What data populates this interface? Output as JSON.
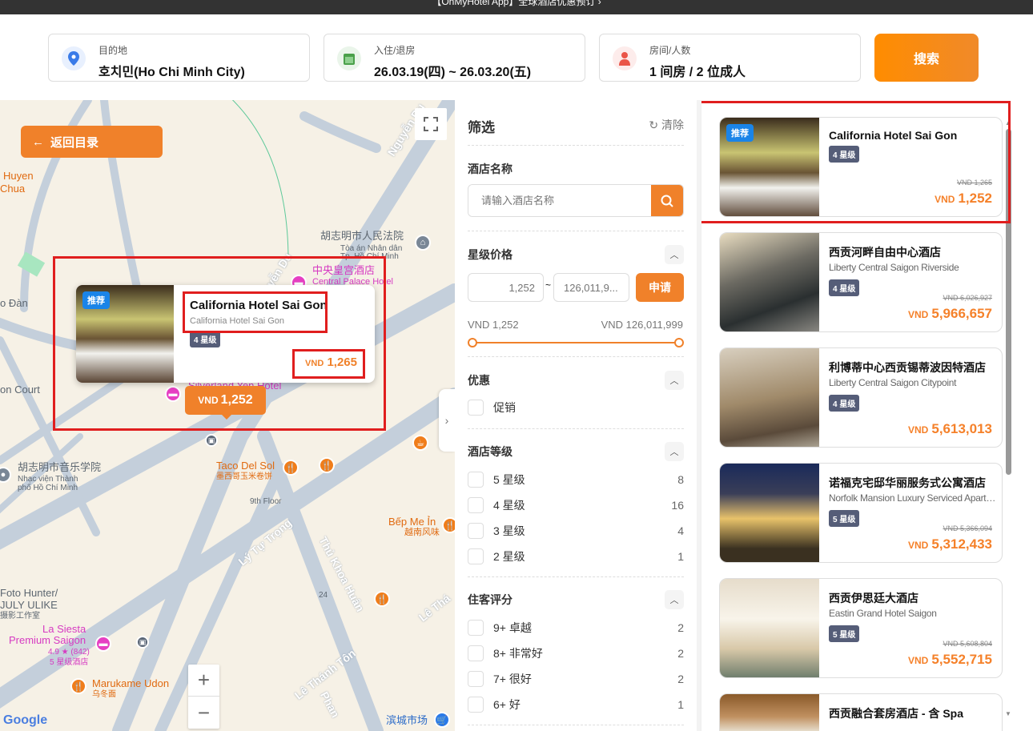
{
  "topbar": {
    "text": "【OhMyHotel App】全球酒店优惠预订 ›"
  },
  "search": {
    "destination": {
      "label": "目的地",
      "value": "호치민(Ho Chi Minh City)",
      "icon": "location-pin-icon"
    },
    "dates": {
      "label": "入住/退房",
      "value": "26.03.19(四) ~ 26.03.20(五)",
      "icon": "calendar-icon"
    },
    "guests": {
      "label": "房间/人数",
      "value": "1 间房 / 2 位成人",
      "icon": "person-icon"
    },
    "button": "搜索"
  },
  "map": {
    "back_button": "返回目录",
    "labels": {
      "huyen": "Huyen",
      "chua": "Chua",
      "court_cn": "胡志明市人民法院",
      "court_vi1": "Tòa án Nhân dân",
      "court_vi2": "Tp. Hồ Chí Minh",
      "central_cn": "中央皇宫酒店",
      "central_en": "Central Palace Hotel",
      "silverland": "Silverland Yen Hotel",
      "doan": "o Đàn",
      "oncourt": "on Court",
      "music_cn": "胡志明市音乐学院",
      "music_vi1": "Nhạc viện Thành",
      "music_vi2": "phố Hồ Chí Minh",
      "taco": "Taco Del Sol",
      "taco_cn": "墨西哥玉米卷饼",
      "ninth": "9th Floor",
      "bep": "Bếp Me Ỉn",
      "bep_cn": "越南风味",
      "foto1": "Foto Hunter/",
      "foto2": "JULY ULIKE",
      "foto3": "摄影工作室",
      "siesta1": "La Siesta",
      "siesta2": "Premium Saigon",
      "siesta3": "4.9 ★ (842)",
      "siesta4": "5 星级酒店",
      "marukame": "Marukame Udon",
      "marukame_cn": "乌冬面",
      "num24": "24",
      "market": "滨城市场",
      "nguyen": "Nguyễn Du",
      "nguyen2": "yễn Du",
      "lytu": "Lý Tự Trọng",
      "thukhoa": "Thủ Khoa Huân",
      "lethanh": "Lê Thánh Tôn",
      "lethanh2": "Lê Thá",
      "phan": "Phan",
      "google": "Google"
    },
    "popup": {
      "badge": "推荐",
      "name": "California Hotel Sai Gon",
      "subname": "California Hotel Sai Gon",
      "stars": "4 星级",
      "currency": "VND",
      "price": "1,265"
    },
    "marker": {
      "currency": "VND",
      "price": "1,252"
    },
    "zoom_in": "+",
    "zoom_out": "−"
  },
  "filter": {
    "title": "筛选",
    "clear": "清除",
    "hotel_name": {
      "title": "酒店名称",
      "placeholder": "请输入酒店名称"
    },
    "price": {
      "title": "星级价格",
      "min_placeholder": "1,252",
      "max_placeholder": "126,011,9...",
      "apply": "申请",
      "min_label": "VND 1,252",
      "max_label": "VND 126,011,999",
      "range_low": 0,
      "range_high": 1
    },
    "deals": {
      "title": "优惠",
      "items": [
        {
          "label": "促销"
        }
      ]
    },
    "grade": {
      "title": "酒店等级",
      "items": [
        {
          "label": "5 星级",
          "count": "8"
        },
        {
          "label": "4 星级",
          "count": "16"
        },
        {
          "label": "3 星级",
          "count": "4"
        },
        {
          "label": "2 星级",
          "count": "1"
        }
      ]
    },
    "rating": {
      "title": "住客评分",
      "items": [
        {
          "label": "9+ 卓越",
          "count": "2"
        },
        {
          "label": "8+ 非常好",
          "count": "2"
        },
        {
          "label": "7+ 很好",
          "count": "2"
        },
        {
          "label": "6+ 好",
          "count": "1"
        }
      ]
    }
  },
  "hotels": [
    {
      "badge": "推荐",
      "name": "California Hotel Sai Gon",
      "stars": "4 星级",
      "old_price": "VND 1,265",
      "currency": "VND",
      "price": "1,252"
    },
    {
      "name": "西贡河畔自由中心酒店",
      "en": "Liberty Central Saigon Riverside",
      "stars": "4 星级",
      "old_price": "VND 6,026,927",
      "currency": "VND",
      "price": "5,966,657"
    },
    {
      "name": "利博蒂中心西贡锡蒂波因特酒店",
      "en": "Liberty Central Saigon Citypoint",
      "stars": "4 星级",
      "currency": "VND",
      "price": "5,613,013"
    },
    {
      "name": "诺福克宅邸华丽服务式公寓酒店",
      "en": "Norfolk Mansion Luxury Serviced Apartment",
      "stars": "5 星级",
      "old_price": "VND 5,366,094",
      "currency": "VND",
      "price": "5,312,433"
    },
    {
      "name": "西贡伊思廷大酒店",
      "en": "Eastin Grand Hotel Saigon",
      "stars": "5 星级",
      "old_price": "VND 5,608,804",
      "currency": "VND",
      "price": "5,552,715"
    },
    {
      "name": "西贡融合套房酒店 - 含 Spa"
    }
  ]
}
